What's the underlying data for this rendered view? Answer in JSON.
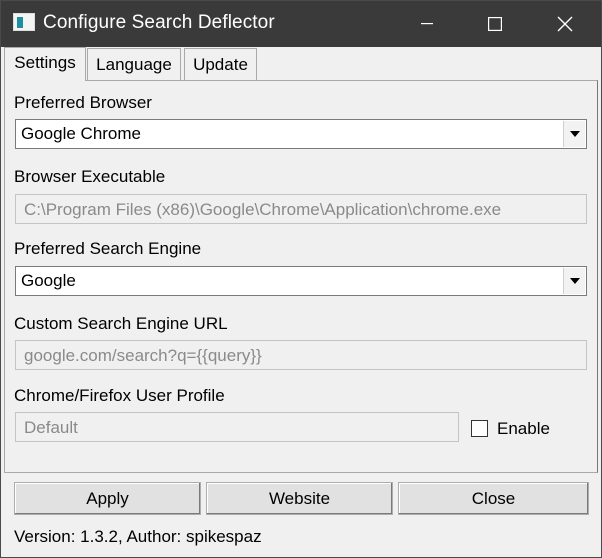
{
  "window": {
    "title": "Configure Search Deflector",
    "icons": {
      "app": "app-window-icon",
      "minimize": "minimize-icon",
      "maximize": "maximize-icon",
      "close": "close-icon"
    }
  },
  "tabs": [
    {
      "label": "Settings",
      "active": true
    },
    {
      "label": "Language",
      "active": false
    },
    {
      "label": "Update",
      "active": false
    }
  ],
  "settings": {
    "preferred_browser": {
      "label": "Preferred Browser",
      "value": "Google Chrome"
    },
    "browser_executable": {
      "label": "Browser Executable",
      "value": "C:\\Program Files (x86)\\Google\\Chrome\\Application\\chrome.exe"
    },
    "preferred_search_engine": {
      "label": "Preferred Search Engine",
      "value": "Google"
    },
    "custom_search_engine_url": {
      "label": "Custom Search Engine URL",
      "value": "google.com/search?q={{query}}"
    },
    "user_profile": {
      "label": "Chrome/Firefox User Profile",
      "value": "Default",
      "enable_label": "Enable",
      "enabled": false
    }
  },
  "buttons": {
    "apply": "Apply",
    "website": "Website",
    "close": "Close"
  },
  "footer": {
    "version_text": "Version: 1.3.2, Author: spikespaz"
  },
  "colors": {
    "titlebar": "#3a3a3a",
    "window_bg": "#f0f0f0",
    "icon_accent": "#1f8fa0"
  }
}
